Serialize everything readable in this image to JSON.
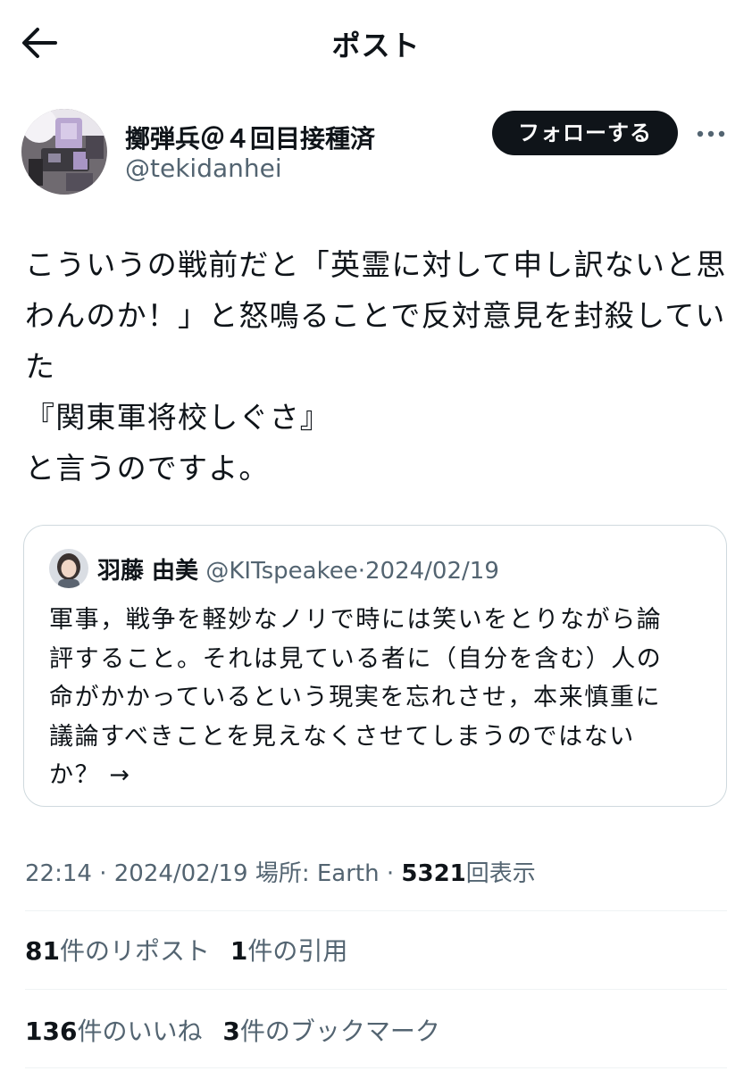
{
  "header": {
    "title": "ポスト",
    "back_icon": "arrow-left-icon"
  },
  "author": {
    "display_name": "擲弾兵＠４回目接種済",
    "handle": "@tekidanhei",
    "follow_label": "フォローする",
    "more_icon": "more-horizontal-icon"
  },
  "post": {
    "lines": [
      "こういうの戦前だと「英霊に対して申し訳ないと思",
      "わんのか！」と怒鳴ることで反対意見を封殺してい",
      "た",
      "『関東軍将校しぐさ』",
      "と言うのですよ。"
    ]
  },
  "quote": {
    "name": "羽藤 由美",
    "handle": "@KITspeakee",
    "separator": "·",
    "date": "2024/02/19",
    "lines": [
      "軍事，戦争を軽妙なノリで時には笑いをとりながら論",
      "評すること。それは見ている者に（自分を含む）人の",
      "命がかかっているという現実を忘れさせ，本来慎重に",
      "議論すべきことを見えなくさせてしまうのではない",
      "か？ →"
    ]
  },
  "meta": {
    "time": "22:14",
    "sep1": "·",
    "date": "2024/02/19",
    "location": "場所: Earth",
    "sep2": "·",
    "views_count": "5321",
    "views_label": "回表示"
  },
  "stats": {
    "reposts_count": "81",
    "reposts_label": "件のリポスト",
    "quotes_count": "1",
    "quotes_label": "件の引用",
    "likes_count": "136",
    "likes_label": "件のいいね",
    "bookmarks_count": "3",
    "bookmarks_label": "件のブックマーク"
  },
  "colors": {
    "text": "#0f1419",
    "muted": "#536471",
    "border": "#cfd9de",
    "divider": "#eff3f4",
    "button_bg": "#0f1419"
  }
}
